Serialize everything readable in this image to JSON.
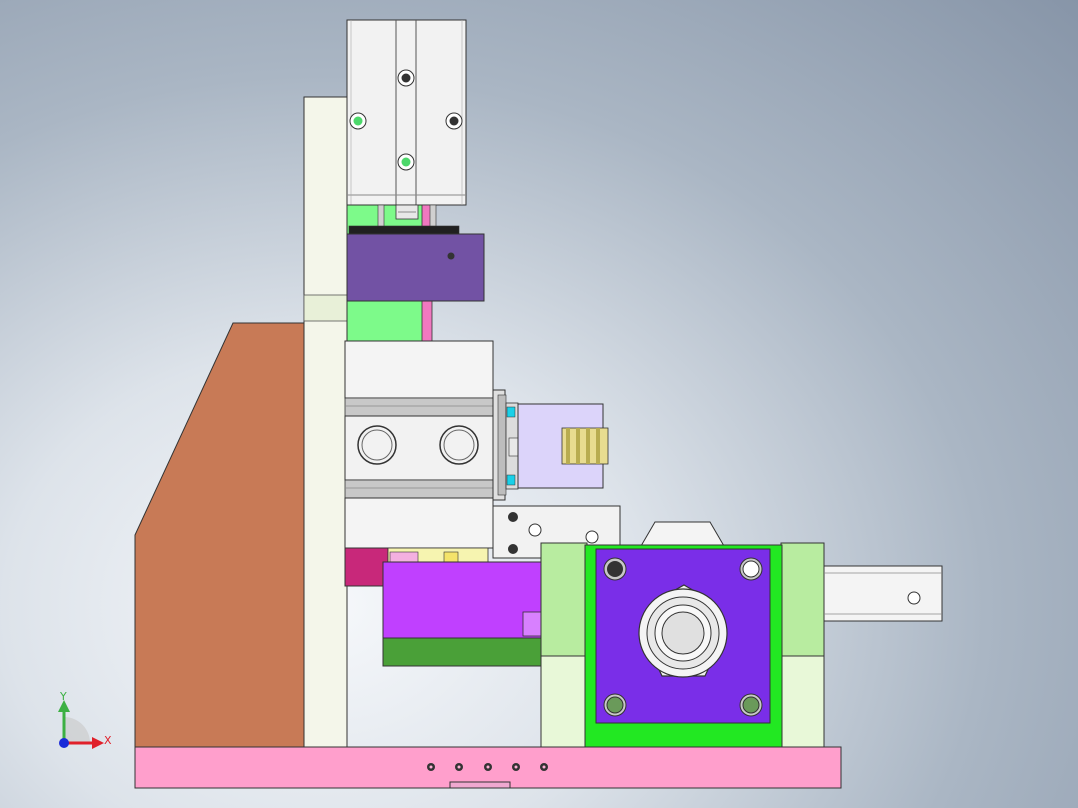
{
  "viewport": {
    "background_colors": [
      "#f6f8fb",
      "#aab6c4",
      "#8795a8"
    ]
  },
  "triad": {
    "x_label": "X",
    "y_label": "Y",
    "x_color": "#e0202a",
    "y_color": "#3cb043",
    "z_color": "#1a2ad8"
  },
  "model_colors": {
    "base_plate": "#ff9fcc",
    "side_bracket": "#c87a56",
    "upright": "#f4f6ea",
    "cylinder_body": "#f2f2f2",
    "green_block": "#7dfa8a",
    "purple_block": "#7252a4",
    "violet_block": "#c040ff",
    "lavender_block": "#dcd4fa",
    "bearing_plate": "#7a2ee8",
    "bearing_frame": "#22e822",
    "side_blocks": "#b8eca0",
    "dark_green": "#4aa038",
    "magenta": "#c8287a"
  }
}
